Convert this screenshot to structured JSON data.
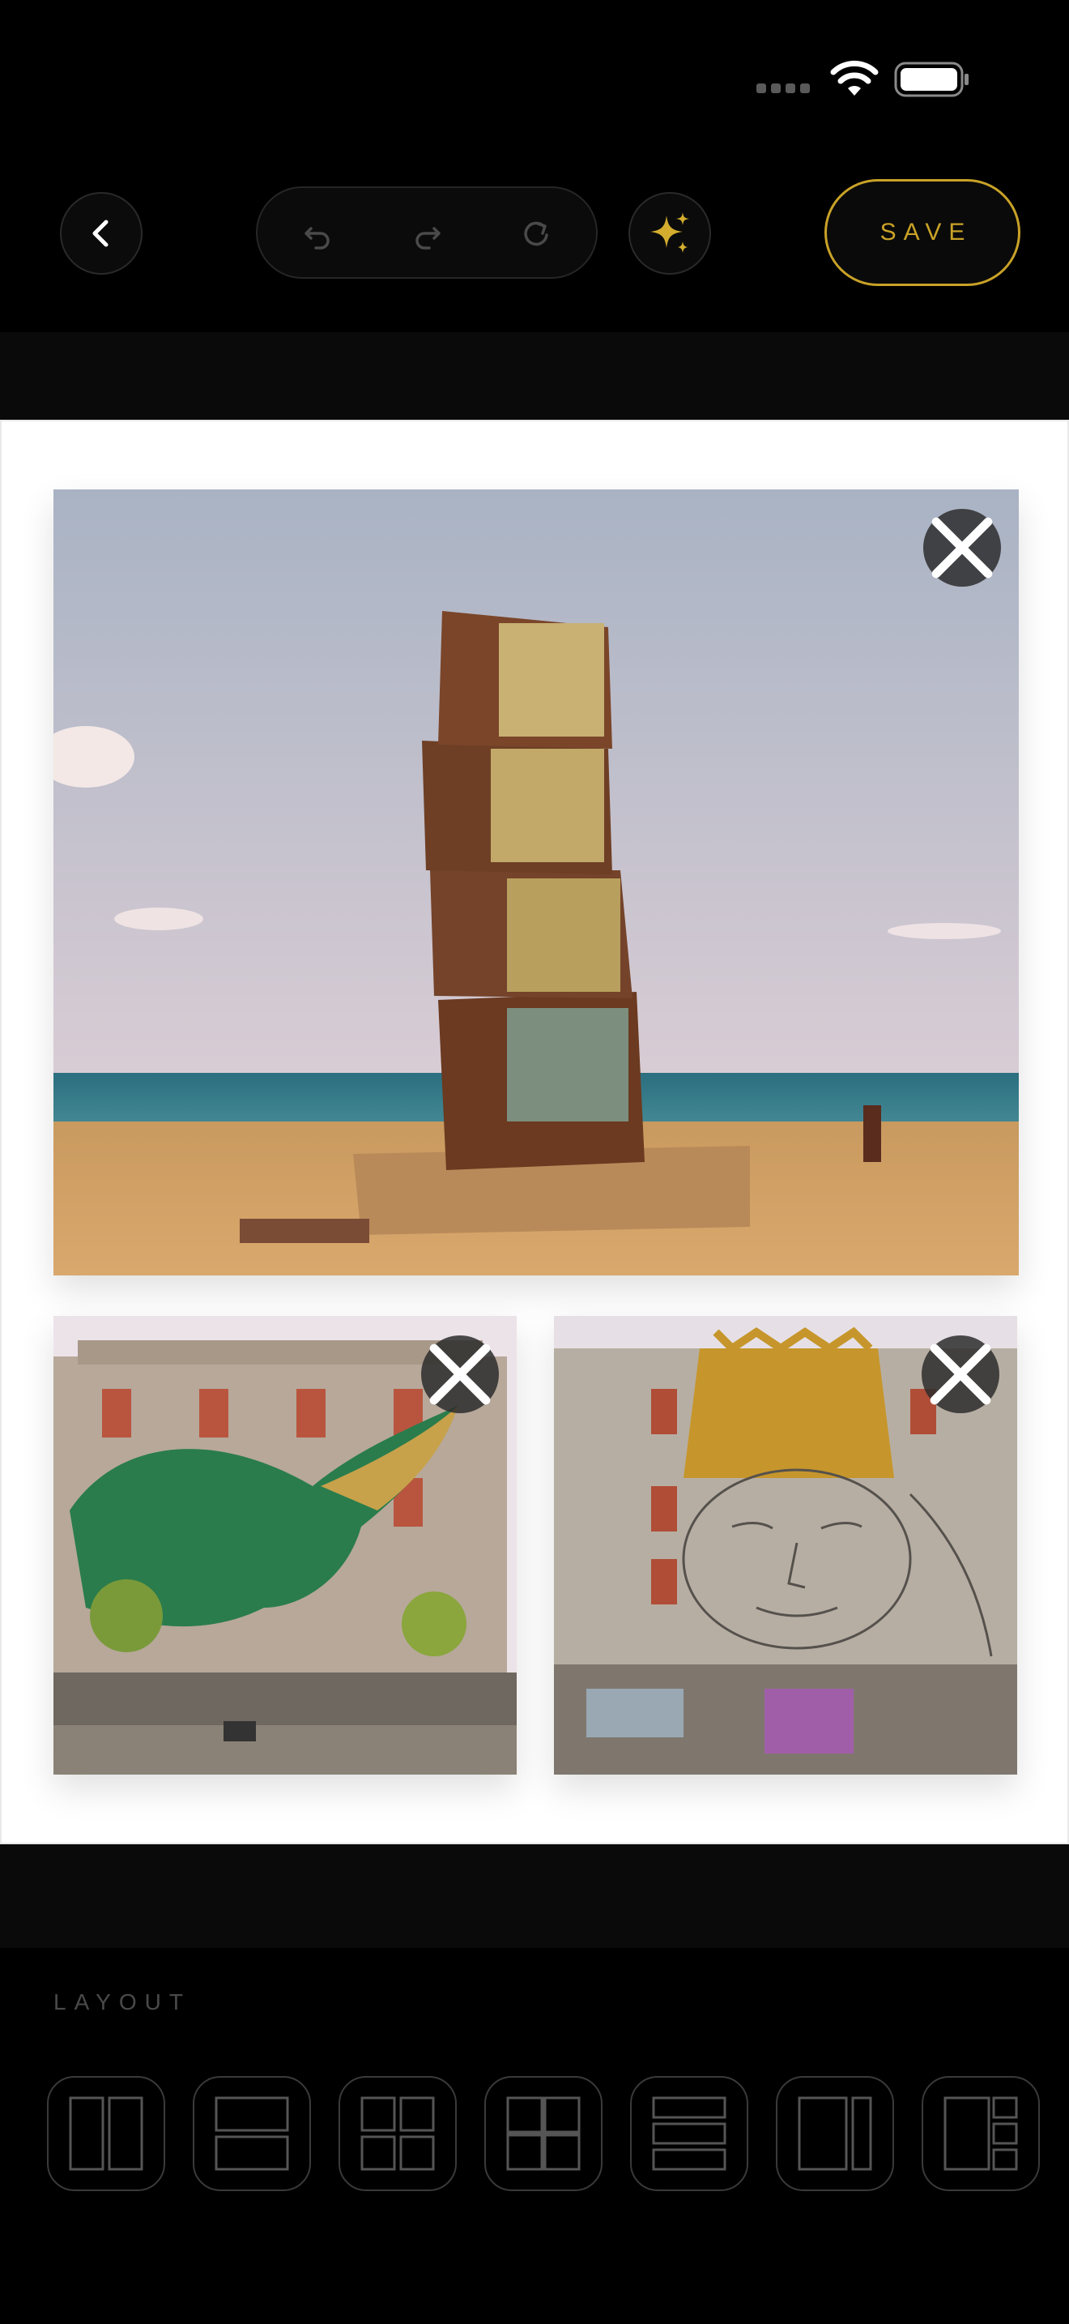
{
  "status_bar": {
    "signal_icon": "signal-dots-icon",
    "wifi_icon": "wifi-icon",
    "battery_icon": "battery-icon"
  },
  "toolbar": {
    "back_icon": "chevron-left-icon",
    "history": [
      "undo-icon",
      "redo-icon",
      "reset-icon"
    ],
    "magic_icon": "sparkles-icon",
    "save_label": "SAVE"
  },
  "colors": {
    "accent": "#c9a227",
    "background": "#000000",
    "canvas": "#ffffff"
  },
  "canvas": {
    "photos": [
      {
        "subject": "beach-tower-sculpture",
        "remove_icon": "close-icon"
      },
      {
        "subject": "building-mural-green-creature",
        "remove_icon": "close-icon"
      },
      {
        "subject": "building-mural-face-crown",
        "remove_icon": "close-icon"
      }
    ]
  },
  "layout": {
    "label": "LAYOUT",
    "options": [
      "two-columns-icon",
      "two-rows-icon",
      "four-grid-icon",
      "four-grid-thick-icon",
      "three-rows-icon",
      "wide-left-column-icon",
      "left-large-right-three-icon"
    ]
  }
}
